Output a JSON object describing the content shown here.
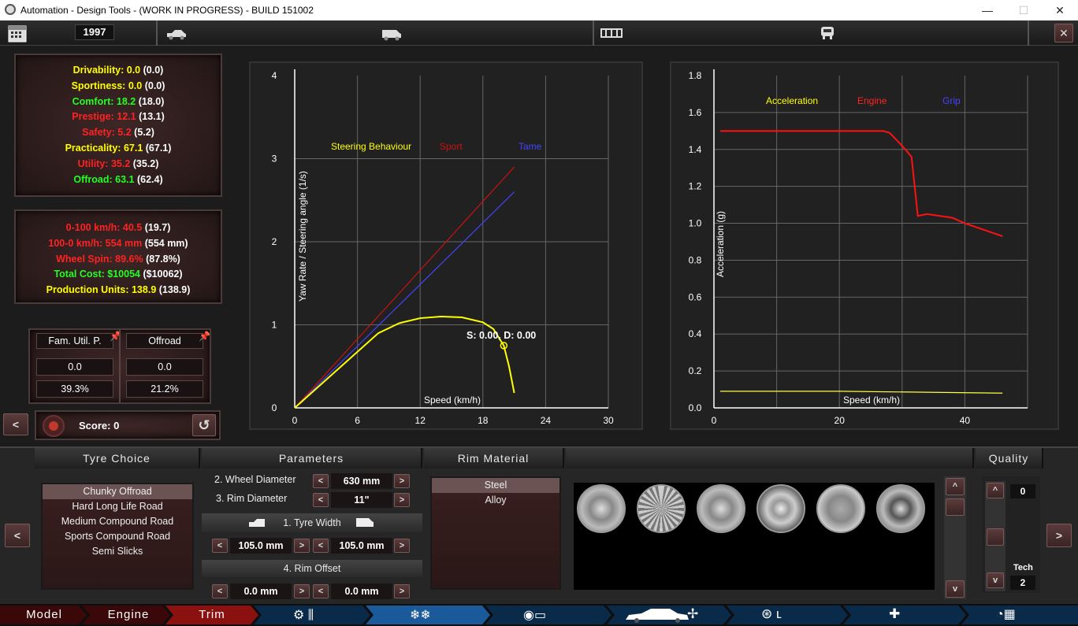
{
  "window": {
    "title": "Automation - Design Tools - (WORK IN PROGRESS) - BUILD 151002"
  },
  "toolbar": {
    "year": "1997"
  },
  "ratings": [
    {
      "label": "Drivability:",
      "value": "0.0",
      "prev": "(0.0)",
      "color": "#ffff00"
    },
    {
      "label": "Sportiness:",
      "value": "0.0",
      "prev": "(0.0)",
      "color": "#ffff00"
    },
    {
      "label": "Comfort:",
      "value": "18.2",
      "prev": "(18.0)",
      "color": "#22ff22"
    },
    {
      "label": "Prestige:",
      "value": "12.1",
      "prev": "(13.1)",
      "color": "#ff2222"
    },
    {
      "label": "Safety:",
      "value": "5.2",
      "prev": "(5.2)",
      "color": "#ff2222"
    },
    {
      "label": "Practicality:",
      "value": "67.1",
      "prev": "(67.1)",
      "color": "#ffff00"
    },
    {
      "label": "Utility:",
      "value": "35.2",
      "prev": "(35.2)",
      "color": "#ff2222"
    },
    {
      "label": "Offroad:",
      "value": "63.1",
      "prev": "(62.4)",
      "color": "#22ff22"
    }
  ],
  "performance": [
    {
      "label": "0-100 km/h:",
      "value": "40.5",
      "prev": "(19.7)",
      "color": "#ff2222"
    },
    {
      "label": "100-0 km/h:",
      "value": "554 mm",
      "prev": "(554 mm)",
      "color": "#ff2222"
    },
    {
      "label": "Wheel Spin:",
      "value": "89.6%",
      "prev": "(87.8%)",
      "color": "#ff2222"
    },
    {
      "label": "Total Cost:",
      "value": "$10054",
      "prev": "($10062)",
      "color": "#22ff22"
    },
    {
      "label": "Production Units:",
      "value": "138.9",
      "prev": "(138.9)",
      "color": "#ffff00"
    }
  ],
  "markets": [
    {
      "name": "Fam. Util. P.",
      "value": "0.0",
      "percent": "39.3%"
    },
    {
      "name": "Offroad",
      "value": "0.0",
      "percent": "21.2%"
    }
  ],
  "score": {
    "label": "Score: 0"
  },
  "steering_chart": {
    "legend": {
      "title": "Steering Behaviour",
      "sport": "Sport",
      "tame": "Tame"
    },
    "annotation": "S: 0.00, D: 0.00"
  },
  "accel_chart": {
    "legend": {
      "acceleration": "Acceleration",
      "engine": "Engine",
      "grip": "Grip"
    }
  },
  "chart_data": [
    {
      "type": "line",
      "xlabel": "Speed (km/h)",
      "ylabel": "Yaw Rate / Steering angle (1/s)",
      "xlim": [
        0,
        30
      ],
      "ylim": [
        0,
        4
      ],
      "xticks": [
        "0",
        "6",
        "12",
        "18",
        "24",
        "30"
      ],
      "yticks": [
        "0",
        "1",
        "2",
        "3",
        "4"
      ],
      "grid": true,
      "series": [
        {
          "name": "Sport",
          "color": "#cc1111",
          "x": [
            0,
            21
          ],
          "y": [
            0,
            2.9
          ]
        },
        {
          "name": "Tame",
          "color": "#4444ff",
          "x": [
            0,
            21
          ],
          "y": [
            0,
            2.6
          ]
        },
        {
          "name": "Steering Behaviour",
          "color": "#ffff00",
          "x": [
            0,
            4,
            8,
            10,
            12,
            14,
            16,
            18,
            19,
            20,
            20.5,
            21
          ],
          "y": [
            0,
            0.45,
            0.9,
            1.02,
            1.08,
            1.1,
            1.09,
            1.03,
            0.95,
            0.75,
            0.5,
            0.18
          ]
        }
      ]
    },
    {
      "type": "line",
      "xlabel": "Speed (km/h)",
      "ylabel": "Acceleration (g)",
      "xlim": [
        0,
        50
      ],
      "ylim": [
        0,
        1.8
      ],
      "xticks": [
        "0",
        "20",
        "40"
      ],
      "yticks": [
        "0.0",
        "0.2",
        "0.4",
        "0.6",
        "0.8",
        "1.0",
        "1.2",
        "1.4",
        "1.6",
        "1.8"
      ],
      "grid": true,
      "series": [
        {
          "name": "Engine",
          "color": "#ff1111",
          "x": [
            1,
            10,
            20,
            27,
            28,
            30,
            31.5,
            32.5,
            34,
            38,
            40,
            46
          ],
          "y": [
            1.5,
            1.5,
            1.5,
            1.5,
            1.49,
            1.42,
            1.36,
            1.04,
            1.05,
            1.03,
            1.0,
            0.93
          ]
        },
        {
          "name": "Acceleration",
          "color": "#ffff44",
          "x": [
            1,
            20,
            46
          ],
          "y": [
            0.09,
            0.09,
            0.08
          ]
        }
      ]
    }
  ],
  "bottom": {
    "tyre_choice": {
      "title": "Tyre Choice",
      "items": [
        "Chunky Offroad",
        "Hard Long Life Road",
        "Medium Compound Road",
        "Sports Compound Road",
        "Semi Slicks"
      ],
      "selected": 0
    },
    "parameters": {
      "title": "Parameters",
      "wheel_diameter": {
        "label": "2. Wheel Diameter",
        "value": "630 mm"
      },
      "rim_diameter": {
        "label": "3. Rim Diameter",
        "value": "11\""
      },
      "tyre_width": {
        "label": "1. Tyre Width",
        "front": "105.0 mm",
        "rear": "105.0 mm"
      },
      "rim_offset": {
        "label": "4. Rim Offset",
        "front": "0.0 mm",
        "rear": "0.0 mm"
      }
    },
    "rim_material": {
      "title": "Rim Material",
      "items": [
        "Steel",
        "Alloy"
      ],
      "selected": 0
    },
    "quality": {
      "title": "Quality",
      "value": "0",
      "tech_label": "Tech",
      "tech_value": "2"
    }
  },
  "nav": {
    "model": "Model",
    "engine": "Engine",
    "trim": "Trim"
  },
  "colors": {
    "accent_red": "#cc2a2a",
    "panel": "#2a1a1a"
  }
}
